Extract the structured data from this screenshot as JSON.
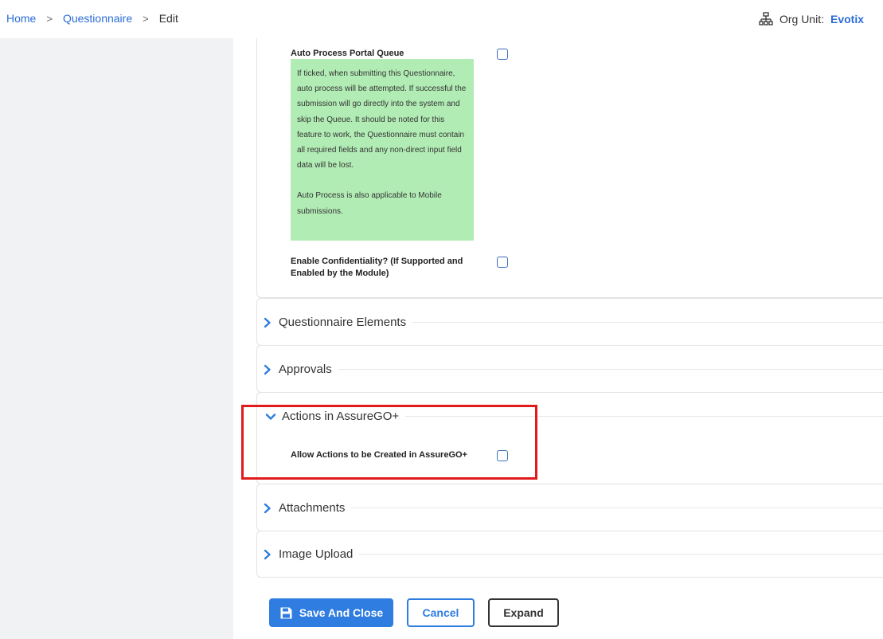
{
  "breadcrumb": {
    "home": "Home",
    "questionnaire": "Questionnaire",
    "edit": "Edit"
  },
  "org_unit": {
    "label": "Org Unit:",
    "value": "Evotix"
  },
  "settings": {
    "auto_process_label": "Auto Process Portal Queue",
    "auto_process_help": "If ticked, when submitting this Questionnaire, auto process will be attempted. If successful the submission will go directly into the system and skip the Queue. It should be noted for this feature to work, the Questionnaire must contain all required fields and any non-direct input field data will be lost.",
    "auto_process_help_2": "Auto Process is also applicable to Mobile submissions.",
    "confidentiality_label": "Enable Confidentiality? (If Supported and Enabled by the Module)"
  },
  "sections": {
    "questionnaire_elements": "Questionnaire Elements",
    "approvals": "Approvals",
    "actions": "Actions in AssureGO+",
    "actions_option": "Allow Actions to be Created in AssureGO+",
    "attachments": "Attachments",
    "image_upload": "Image Upload"
  },
  "buttons": {
    "save_close": "Save And Close",
    "cancel": "Cancel",
    "expand": "Expand"
  },
  "colors": {
    "accent": "#2f7de1",
    "help_bg": "#b2ecb5",
    "highlight": "#e01b1b",
    "sidebar": "#f1f2f4"
  }
}
